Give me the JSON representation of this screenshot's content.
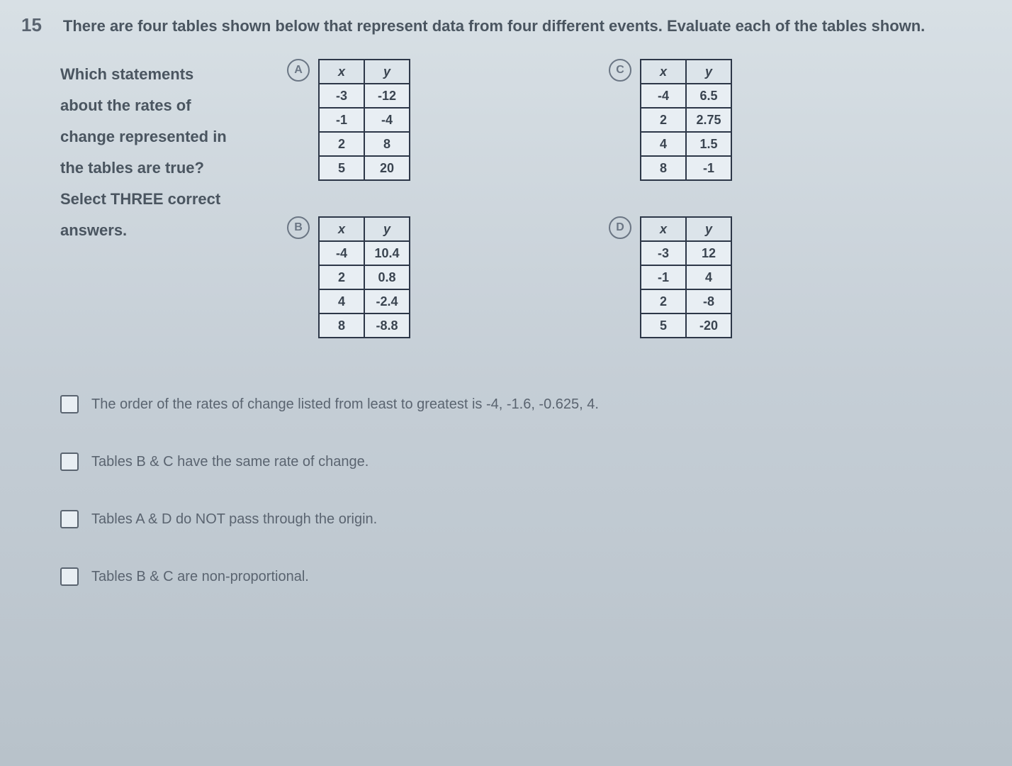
{
  "question_number": "15",
  "question_text": "There are four tables shown below that represent data from four different events. Evaluate each of the tables shown.",
  "left_text_lines": [
    "Which statements",
    "about the rates of",
    "change represented in",
    "the tables are true?",
    "Select THREE correct",
    "answers."
  ],
  "tables": {
    "A": {
      "label": "A",
      "headers": [
        "x",
        "y"
      ],
      "rows": [
        [
          "-3",
          "-12"
        ],
        [
          "-1",
          "-4"
        ],
        [
          "2",
          "8"
        ],
        [
          "5",
          "20"
        ]
      ]
    },
    "B": {
      "label": "B",
      "headers": [
        "x",
        "y"
      ],
      "rows": [
        [
          "-4",
          "10.4"
        ],
        [
          "2",
          "0.8"
        ],
        [
          "4",
          "-2.4"
        ],
        [
          "8",
          "-8.8"
        ]
      ]
    },
    "C": {
      "label": "C",
      "headers": [
        "x",
        "y"
      ],
      "rows": [
        [
          "-4",
          "6.5"
        ],
        [
          "2",
          "2.75"
        ],
        [
          "4",
          "1.5"
        ],
        [
          "8",
          "-1"
        ]
      ]
    },
    "D": {
      "label": "D",
      "headers": [
        "x",
        "y"
      ],
      "rows": [
        [
          "-3",
          "12"
        ],
        [
          "-1",
          "4"
        ],
        [
          "2",
          "-8"
        ],
        [
          "5",
          "-20"
        ]
      ]
    }
  },
  "answers": [
    "The order of the rates of change listed from least to greatest is -4, -1.6, -0.625, 4.",
    "Tables B & C have the same rate of change.",
    "Tables A & D do NOT pass through the origin.",
    "Tables B & C are non-proportional."
  ]
}
